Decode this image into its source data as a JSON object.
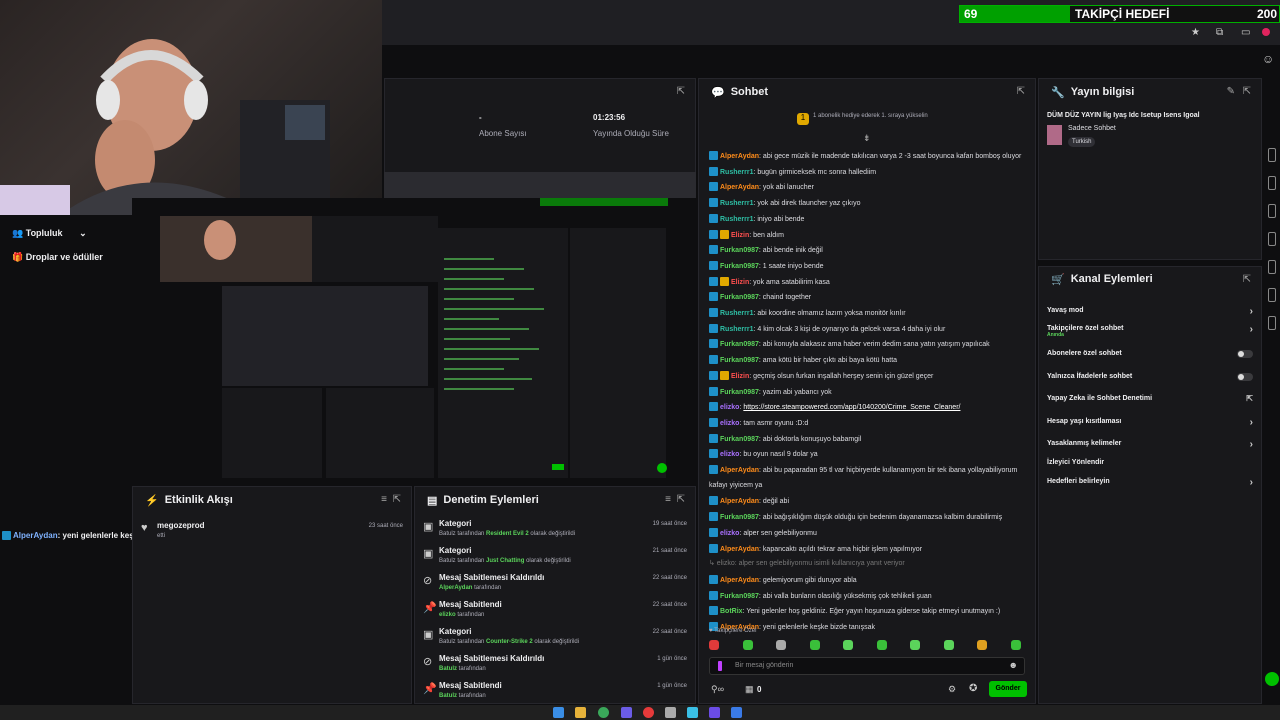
{
  "goal": {
    "value": "69",
    "label": "TAKİPÇİ HEDEFİ",
    "target": "200",
    "progress_fraction": 0.345
  },
  "stats": {
    "followers_sub": "-",
    "subscribers_label": "Abone Sayısı",
    "live_time": "01:23:56",
    "live_label": "Yayında Olduğu Süre"
  },
  "sidebar": {
    "community": "Topluluk",
    "drops": "Droplar ve ödüller"
  },
  "overlay_message": {
    "user": "AlperAydan",
    "text": ": yeni gelenlerle keşke bizde tanışsak"
  },
  "events": {
    "title": "Etkinlik Akışı",
    "items": [
      {
        "user": "megozeprod",
        "sub": "etti",
        "time": "23 saat önce"
      }
    ]
  },
  "mod": {
    "title": "Denetim Eylemleri",
    "items": [
      {
        "title": "Kategori",
        "prefix": "Batulz tarafından",
        "hl": "Resident Evil 2",
        "suffix": "olarak değiştirildi",
        "time": "19 saat önce",
        "icon": "category-icon"
      },
      {
        "title": "Kategori",
        "prefix": "Batulz tarafından",
        "hl": "Just Chatting",
        "suffix": "olarak değiştirildi",
        "time": "21 saat önce",
        "icon": "category-icon"
      },
      {
        "title": "Mesaj Sabitlemesi Kaldırıldı",
        "prefix": "",
        "hl": "AlperAydan",
        "suffix": "tarafından",
        "time": "22 saat önce",
        "icon": "unpin-icon"
      },
      {
        "title": "Mesaj Sabitlendi",
        "prefix": "",
        "hl": "elizko",
        "suffix": "tarafından",
        "time": "22 saat önce",
        "icon": "pin-icon"
      },
      {
        "title": "Kategori",
        "prefix": "Batulz tarafından",
        "hl": "Counter-Strike 2",
        "suffix": "olarak değiştirildi",
        "time": "22 saat önce",
        "icon": "category-icon"
      },
      {
        "title": "Mesaj Sabitlemesi Kaldırıldı",
        "prefix": "",
        "hl": "Batulz",
        "suffix": "tarafından",
        "time": "1 gün önce",
        "icon": "unpin-icon"
      },
      {
        "title": "Mesaj Sabitlendi",
        "prefix": "",
        "hl": "Batulz",
        "suffix": "tarafından",
        "time": "1 gün önce",
        "icon": "pin-icon"
      }
    ]
  },
  "chat": {
    "title": "Sohbet",
    "gift_banner": "1 abonelik hediye ederek 1. sıraya yükselin",
    "messages": [
      {
        "user": "AlperAydan",
        "color": "#ff8c1a",
        "badge": "#1e90c8",
        "text": ": abi gece müzik ile madende takılıcan varya 2 -3 saat boyunca kafan bomboş oluyor"
      },
      {
        "user": "Rusherrr1",
        "color": "#2ebfa5",
        "badge": "#1e90c8",
        "text": ": bugün girmiceksek mc sonra hallediim"
      },
      {
        "user": "AlperAydan",
        "color": "#ff8c1a",
        "badge": "#1e90c8",
        "text": ": yok abi lanucher"
      },
      {
        "user": "Rusherrr1",
        "color": "#2ebfa5",
        "badge": "#1e90c8",
        "text": ": yok abi direk tlauncher yaz çıkıyo"
      },
      {
        "user": "Rusherrr1",
        "color": "#2ebfa5",
        "badge": "#1e90c8",
        "text": ": iniyo abi bende"
      },
      {
        "user": "Elizin",
        "color": "#ff4f4f",
        "badge": "#e0a800",
        "text": ": ben aldım"
      },
      {
        "user": "Furkan0987",
        "color": "#5bd45b",
        "badge": "",
        "text": ": abi bende inik değil"
      },
      {
        "user": "Furkan0987",
        "color": "#5bd45b",
        "badge": "",
        "text": ": 1 saate iniyo bende"
      },
      {
        "user": "Elizin",
        "color": "#ff4f4f",
        "badge": "#e0a800",
        "text": ": yok ama satabilirim kasa"
      },
      {
        "user": "Furkan0987",
        "color": "#5bd45b",
        "badge": "",
        "text": ": chaind together"
      },
      {
        "user": "Rusherrr1",
        "color": "#2ebfa5",
        "badge": "#1e90c8",
        "text": ": abi koordine olmamız lazım yoksa monitör kırılır"
      },
      {
        "user": "Rusherrr1",
        "color": "#2ebfa5",
        "badge": "#1e90c8",
        "text": ": 4 kim olcak 3 kişi de oynarıyo da gelcek varsa 4 daha iyi olur"
      },
      {
        "user": "Furkan0987",
        "color": "#5bd45b",
        "badge": "",
        "text": ": abi konuyla alakasız ama haber verim dedim sana yatın yatışım yapılıcak"
      },
      {
        "user": "Furkan0987",
        "color": "#5bd45b",
        "badge": "",
        "text": ": ama kötü bir haber çıktı abi baya kötü hatta"
      },
      {
        "user": "Elizin",
        "color": "#ff4f4f",
        "badge": "#e0a800",
        "text": ": geçmiş olsun furkan inşallah herşey senin için güzel geçer"
      },
      {
        "user": "Furkan0987",
        "color": "#5bd45b",
        "badge": "",
        "text": ": yazim abi yabancı yok"
      },
      {
        "user": "elizko",
        "color": "#a970ff",
        "badge": "",
        "text": ": ",
        "link": "https://store.steampowered.com/app/1040200/Crime_Scene_Cleaner/"
      },
      {
        "user": "elizko",
        "color": "#a970ff",
        "badge": "",
        "text": ": tam asmr oyunu :D:d"
      },
      {
        "user": "Furkan0987",
        "color": "#5bd45b",
        "badge": "",
        "text": ": abi doktorla konuşuyo babamgil"
      },
      {
        "user": "elizko",
        "color": "#a970ff",
        "badge": "",
        "text": ": bu oyun nasıl 9 dolar ya"
      },
      {
        "user": "AlperAydan",
        "color": "#ff8c1a",
        "badge": "",
        "text": ": abi bu paparadan 95 tl var hiçbiryerde kullanamıyom bir tek ibana yollayabiliyorum"
      },
      {
        "user": "",
        "color": "#dedee3",
        "badge": "",
        "text": "kafayı yiyicem ya"
      },
      {
        "user": "AlperAydan",
        "color": "#ff8c1a",
        "badge": "",
        "text": ": değil abi"
      },
      {
        "user": "Furkan0987",
        "color": "#5bd45b",
        "badge": "",
        "text": ": abi bağışıklığım düşük olduğu için bedenim dayanamazsa kalbim durabilirmiş"
      },
      {
        "user": "elizko",
        "color": "#a970ff",
        "badge": "",
        "text": ": alper sen gelebiliyonmu"
      },
      {
        "user": "AlperAydan",
        "color": "#ff8c1a",
        "badge": "",
        "text": ": kapancaktı açıldı tekrar ama hiçbir işlem yapılmıyor"
      },
      {
        "user": "",
        "color": "#777",
        "badge": "",
        "text": "↳ elizko: alper sen gelebiliyonmu isimli kullanıcıya yanıt veriyor"
      },
      {
        "user": "AlperAydan",
        "color": "#ff8c1a",
        "badge": "",
        "text": ": gelemiyorum gibi duruyor abla"
      },
      {
        "user": "Furkan0987",
        "color": "#5bd45b",
        "badge": "",
        "text": ": abi valla bunların olasılığı yüksekmiş çok tehlikeli şuan"
      },
      {
        "user": "BotRix",
        "color": "#5bd45b",
        "badge": "#1e90c8",
        "text": ": Yeni gelenler hoş geldiniz. Eğer yayın hoşunuza giderse takip etmeyi unutmayın :)"
      },
      {
        "user": "AlperAydan",
        "color": "#ff8c1a",
        "badge": "#1e90c8",
        "text": ": yeni gelenlerle keşke bizde tanışsak"
      }
    ],
    "followers_only": "Takipçilere Özel",
    "input_placeholder": "Bir mesaj gönderin",
    "count": "0",
    "send": "Gönder"
  },
  "stream_info": {
    "title": "Yayın bilgisi",
    "stream_title": "DÜM DÜZ YAYIN lig Iyaş Idc Isetup Isens Igoal",
    "category": "Sadece Sohbet",
    "language": "Turkish"
  },
  "channel_actions": {
    "title": "Kanal Eylemleri",
    "items": [
      {
        "label": "Yavaş mod",
        "sub": "",
        "ctrl": "chevron"
      },
      {
        "label": "Takipçilere özel sohbet",
        "sub": "Anında",
        "ctrl": "chevron"
      },
      {
        "label": "Abonelere özel sohbet",
        "sub": "",
        "ctrl": "toggle"
      },
      {
        "label": "Yalnızca İfadelerle sohbet",
        "sub": "",
        "ctrl": "toggle"
      },
      {
        "label": "Yapay Zeka ile Sohbet Denetimi",
        "sub": "",
        "ctrl": "external"
      },
      {
        "label": "Hesap yaşı kısıtlaması",
        "sub": "",
        "ctrl": "chevron"
      },
      {
        "label": "Yasaklanmış kelimeler",
        "sub": "",
        "ctrl": "chevron"
      },
      {
        "label": "İzleyici Yönlendir",
        "sub": "",
        "ctrl": "none"
      },
      {
        "label": "Hedefleri belirleyin",
        "sub": "",
        "ctrl": "chevron"
      }
    ]
  }
}
